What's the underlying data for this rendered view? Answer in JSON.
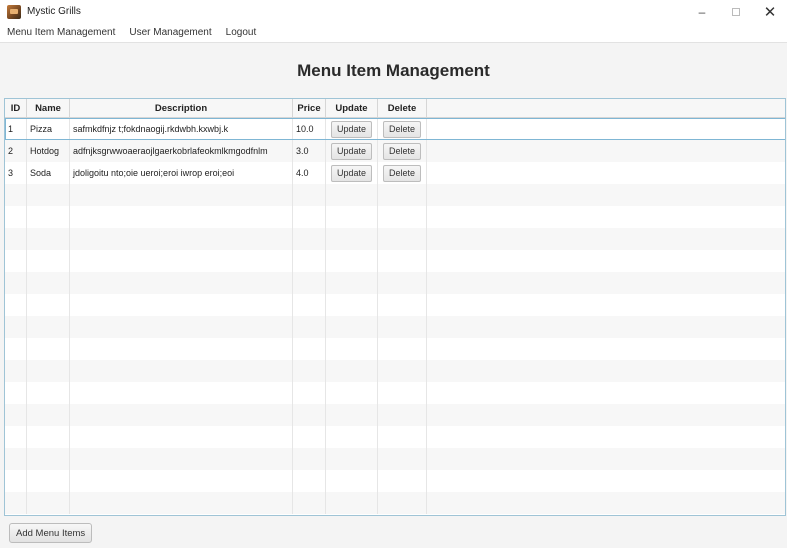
{
  "window": {
    "title": "Mystic Grills",
    "minimize": "–",
    "close": "✕"
  },
  "menu": [
    "Menu Item Management",
    "User Management",
    "Logout"
  ],
  "page_title": "Menu Item Management",
  "table": {
    "columns": [
      "ID",
      "Name",
      "Description",
      "Price",
      "Update",
      "Delete"
    ],
    "rows": [
      {
        "id": "1",
        "name": "Pizza",
        "description": "safmkdfnjz t;fokdnaogij.rkdwbh.kxwbj.k",
        "price": "10.0",
        "update_label": "Update",
        "delete_label": "Delete"
      },
      {
        "id": "2",
        "name": "Hotdog",
        "description": "adfnjksgrwwoaeraojlgaerkobrlafeokmlkmgodfnlm",
        "price": "3.0",
        "update_label": "Update",
        "delete_label": "Delete"
      },
      {
        "id": "3",
        "name": "Soda",
        "description": "jdoligoitu nto;oie ueroi;eroi iwrop eroi;eoi",
        "price": "4.0",
        "update_label": "Update",
        "delete_label": "Delete"
      }
    ],
    "selected_row": 0
  },
  "footer": {
    "add_label": "Add Menu Items"
  }
}
